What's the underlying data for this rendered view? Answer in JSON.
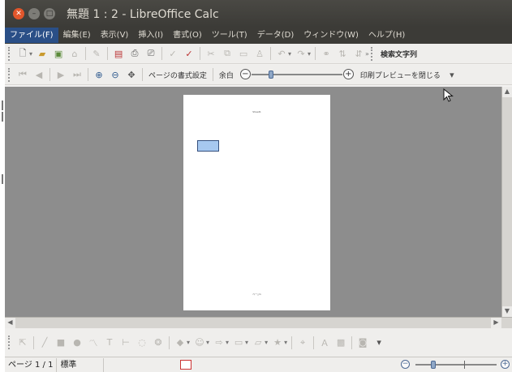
{
  "window": {
    "title": "無題 1 : 2 - LibreOffice Calc"
  },
  "menubar": {
    "items": [
      {
        "label": "ファイル(F)",
        "active": true
      },
      {
        "label": "編集(E)"
      },
      {
        "label": "表示(V)"
      },
      {
        "label": "挿入(I)"
      },
      {
        "label": "書式(O)"
      },
      {
        "label": "ツール(T)"
      },
      {
        "label": "データ(D)"
      },
      {
        "label": "ウィンドウ(W)"
      },
      {
        "label": "ヘルプ(H)"
      }
    ]
  },
  "standard_toolbar": {
    "find_text_label": "検索文字列"
  },
  "preview_toolbar": {
    "page_format_label": "ページの書式設定",
    "margins_label": "余白",
    "close_preview_label": "印刷プレビューを閉じる",
    "zoom_percent": 55
  },
  "preview_page": {
    "header_text": "Sheet1",
    "footer_text": "ページ1"
  },
  "statusbar": {
    "page_indicator": "ページ 1 / 1",
    "page_style": "標準",
    "zoom_percent": 55
  },
  "colors": {
    "titlebar": "#3c3b37",
    "menu_active": "#2a4f87",
    "close_button": "#e2562b",
    "canvas": "#8d8d8d",
    "selected_cell": "#a6c8f0"
  }
}
